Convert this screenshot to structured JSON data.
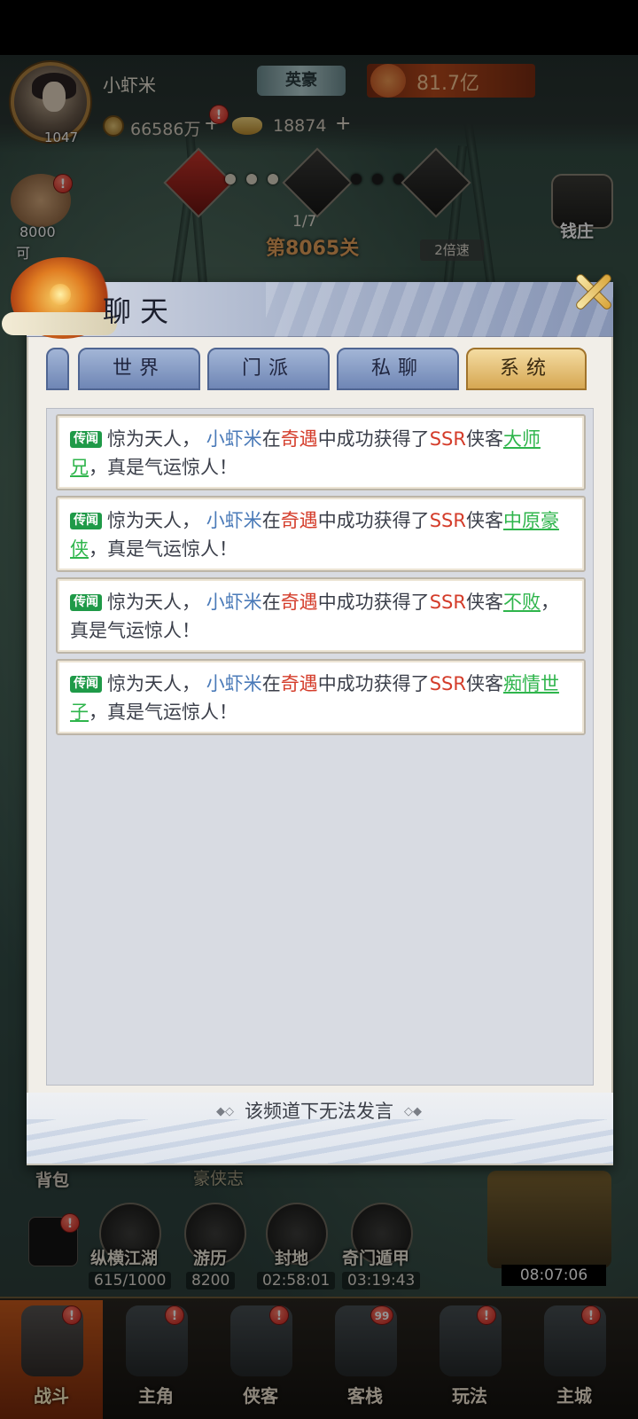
{
  "player": {
    "name": "小虾米",
    "level": "1047",
    "title": "英豪",
    "power": "81.7亿",
    "coins": "66586万",
    "ingots": "18874",
    "plus": "+"
  },
  "stage": {
    "progress": "1/7",
    "name": "第8065关",
    "speed": "2倍速"
  },
  "side_left": {
    "value": "8000",
    "label": "可"
  },
  "side_right": {
    "label": "钱庄"
  },
  "chat": {
    "title": "聊天",
    "tabs": [
      {
        "label": "世界",
        "active": false
      },
      {
        "label": "门派",
        "active": false
      },
      {
        "label": "私聊",
        "active": false
      },
      {
        "label": "系统",
        "active": true
      }
    ],
    "messages": [
      {
        "tag": "传闻",
        "intro": "惊为天人，",
        "player": "小虾米",
        "mid": "在",
        "event": "奇遇",
        "mid2": "中成功获得了",
        "rarity": "SSR",
        "kind": "侠客",
        "hero": "大师兄",
        "outro": "，真是气运惊人！"
      },
      {
        "tag": "传闻",
        "intro": "惊为天人，",
        "player": "小虾米",
        "mid": "在",
        "event": "奇遇",
        "mid2": "中成功获得了",
        "rarity": "SSR",
        "kind": "侠客",
        "hero": "中原豪侠",
        "outro": "，真是气运惊人！"
      },
      {
        "tag": "传闻",
        "intro": "惊为天人，",
        "player": "小虾米",
        "mid": "在",
        "event": "奇遇",
        "mid2": "中成功获得了",
        "rarity": "SSR",
        "kind": "侠客",
        "hero": "不败",
        "outro": "，真是气运惊人！"
      },
      {
        "tag": "传闻",
        "intro": "惊为天人，",
        "player": "小虾米",
        "mid": "在",
        "event": "奇遇",
        "mid2": "中成功获得了",
        "rarity": "SSR",
        "kind": "侠客",
        "hero": "痴情世子",
        "outro": "，真是气运惊人！"
      }
    ],
    "footer": "该频道下无法发言"
  },
  "bottom_area": {
    "bag_label": "背包",
    "banner": "豪侠志",
    "functions": [
      {
        "label": "纵横江湖",
        "value": "615/1000"
      },
      {
        "label": "游历",
        "value": "8200"
      },
      {
        "label": "封地",
        "value": "02:58:01"
      },
      {
        "label": "奇门遁甲",
        "value": "03:19:43"
      }
    ],
    "clock": "08:07:06"
  },
  "nav": [
    {
      "label": "战斗",
      "active": true,
      "badge": "!"
    },
    {
      "label": "主角",
      "active": false,
      "badge": "!"
    },
    {
      "label": "侠客",
      "active": false,
      "badge": "!"
    },
    {
      "label": "客栈",
      "active": false,
      "badge": "99"
    },
    {
      "label": "玩法",
      "active": false,
      "badge": "!"
    },
    {
      "label": "主城",
      "active": false,
      "badge": "!"
    }
  ],
  "colors": {
    "tab_active": "#d6a752",
    "tab_inactive": "#6f86b5",
    "player_name": "#4a7ab8",
    "event_red": "#d43c2a",
    "hero_green": "#2fb54c",
    "tag_green": "#1f9a48"
  },
  "icons": {
    "close": "close-x-icon",
    "chat_emblem": "dragon-emblem-icon",
    "coin": "coin-icon",
    "ingot": "ingot-icon",
    "power": "power-icon"
  }
}
